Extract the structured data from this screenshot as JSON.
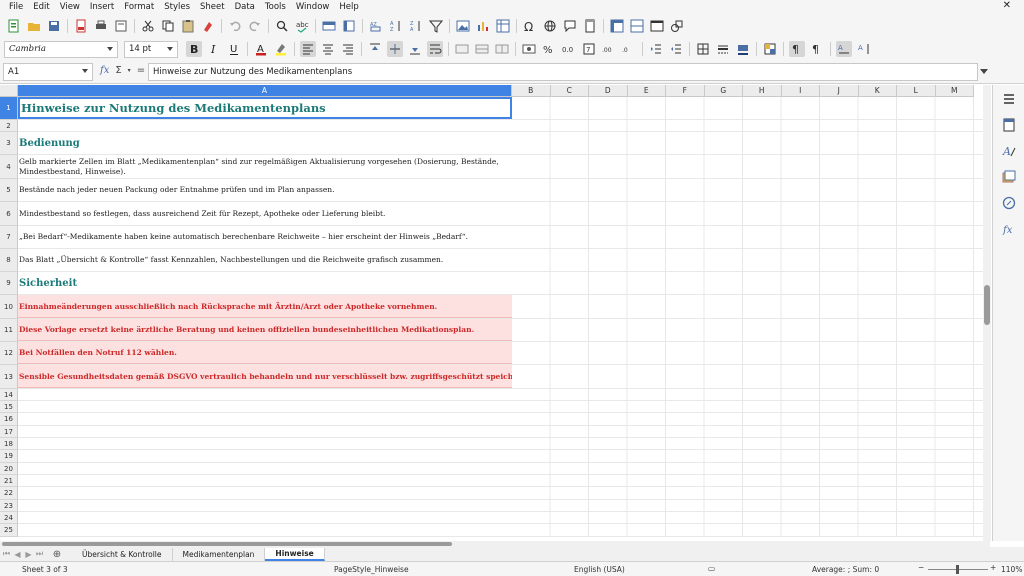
{
  "menu": [
    "File",
    "Edit",
    "View",
    "Insert",
    "Format",
    "Styles",
    "Sheet",
    "Data",
    "Tools",
    "Window",
    "Help"
  ],
  "font": {
    "name": "Cambria",
    "size": "14 pt"
  },
  "formula": {
    "cell_ref": "A1",
    "content": "Hinweise zur Nutzung des Medikamentenplans"
  },
  "columns": [
    "A",
    "B",
    "C",
    "D",
    "E",
    "F",
    "G",
    "H",
    "I",
    "J",
    "K",
    "L",
    "M"
  ],
  "rows": [
    {
      "num": "1",
      "text": "Hinweise zur Nutzung des Medikamentenplans"
    },
    {
      "num": "2",
      "text": ""
    },
    {
      "num": "3",
      "text": "Bedienung"
    },
    {
      "num": "4",
      "text": "Gelb markierte Zellen im Blatt „Medikamentenplan“ sind zur regelmäßigen Aktualisierung vorgesehen (Dosierung, Bestände, Mindestbestand, Hinweise)."
    },
    {
      "num": "5",
      "text": "Bestände nach jeder neuen Packung oder Entnahme prüfen und im Plan anpassen."
    },
    {
      "num": "6",
      "text": "Mindestbestand so festlegen, dass ausreichend Zeit für Rezept, Apotheke oder Lieferung bleibt."
    },
    {
      "num": "7",
      "text": "„Bei Bedarf“-Medikamente haben keine automatisch berechenbare Reichweite – hier erscheint der Hinweis „Bedarf“."
    },
    {
      "num": "8",
      "text": "Das Blatt „Übersicht & Kontrolle“ fasst Kennzahlen, Nachbestellungen und die Reichweite grafisch zusammen."
    },
    {
      "num": "9",
      "text": "Sicherheit"
    },
    {
      "num": "10",
      "text": "Einnahmeänderungen ausschließlich nach Rücksprache mit Ärztin/Arzt oder Apotheke vornehmen."
    },
    {
      "num": "11",
      "text": "Diese Vorlage ersetzt keine ärztliche Beratung und keinen offiziellen bundeseinheitlichen Medikationsplan."
    },
    {
      "num": "12",
      "text": "Bei Notfällen den Notruf 112 wählen."
    },
    {
      "num": "13",
      "text": "Sensible Gesundheitsdaten gemäß DSGVO vertraulich behandeln und nur verschlüsselt bzw. zugriffsgeschützt speichern."
    },
    {
      "num": "14",
      "text": ""
    },
    {
      "num": "15",
      "text": ""
    },
    {
      "num": "16",
      "text": ""
    },
    {
      "num": "17",
      "text": ""
    },
    {
      "num": "18",
      "text": ""
    },
    {
      "num": "19",
      "text": ""
    },
    {
      "num": "20",
      "text": ""
    },
    {
      "num": "21",
      "text": ""
    },
    {
      "num": "22",
      "text": ""
    },
    {
      "num": "23",
      "text": ""
    },
    {
      "num": "24",
      "text": ""
    },
    {
      "num": "25",
      "text": ""
    }
  ],
  "tabs": [
    "Übersicht & Kontrolle",
    "Medikamentenplan",
    "Hinweise"
  ],
  "active_tab": "Hinweise",
  "status": {
    "sheet": "Sheet 3 of 3",
    "page_style": "PageStyle_Hinweise",
    "language": "English (USA)",
    "summary": "Average: ; Sum: 0",
    "zoom": "110%"
  },
  "colors": {
    "title": "#1b7a78",
    "warning_text": "#cc2a2a",
    "warning_fill": "#fde1e1",
    "selection": "#3f84e5"
  }
}
